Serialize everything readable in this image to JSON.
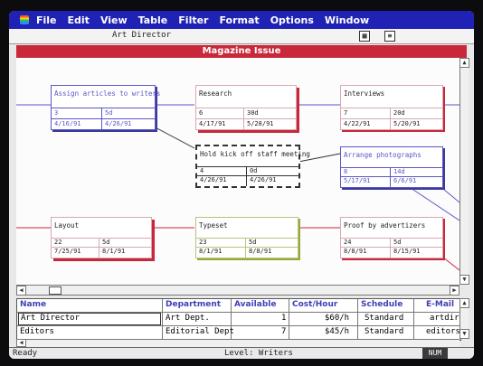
{
  "menubar": {
    "items": [
      "File",
      "Edit",
      "View",
      "Table",
      "Filter",
      "Format",
      "Options",
      "Window"
    ]
  },
  "toolbar": {
    "resource_name": "Art Director"
  },
  "window": {
    "title": "Magazine Issue"
  },
  "tasks": [
    {
      "name": "Assign articles to writers",
      "id": "3",
      "duration": "5d",
      "start": "4/16/91",
      "end": "4/26/91",
      "style": "blue"
    },
    {
      "name": "Research",
      "id": "6",
      "duration": "30d",
      "start": "4/17/91",
      "end": "5/28/91",
      "style": "red"
    },
    {
      "name": "Interviews",
      "id": "7",
      "duration": "20d",
      "start": "4/22/91",
      "end": "5/20/91",
      "style": "pink"
    },
    {
      "name": "Hold kick off staff meeting",
      "id": "4",
      "duration": "0d",
      "start": "4/26/91",
      "end": "4/26/91",
      "style": "dashed"
    },
    {
      "name": "Arrange photographs",
      "id": "8",
      "duration": "14d",
      "start": "5/17/91",
      "end": "6/6/91",
      "style": "blue"
    },
    {
      "name": "Layout",
      "id": "22",
      "duration": "5d",
      "start": "7/25/91",
      "end": "8/1/91",
      "style": "red"
    },
    {
      "name": "Typeset",
      "id": "23",
      "duration": "5d",
      "start": "8/1/91",
      "end": "8/8/91",
      "style": "yellow"
    },
    {
      "name": "Proof by advertizers",
      "id": "24",
      "duration": "5d",
      "start": "8/8/91",
      "end": "8/15/91",
      "style": "pink"
    }
  ],
  "resources": {
    "columns": [
      "Name",
      "Department",
      "Available",
      "Cost/Hour",
      "Schedule",
      "E-Mail"
    ],
    "rows": [
      {
        "name": "Art Director",
        "department": "Art Dept.",
        "available": "1",
        "cost": "$60/h",
        "schedule": "Standard",
        "email": "artdir"
      },
      {
        "name": "Editors",
        "department": "Editorial Dept",
        "available": "7",
        "cost": "$45/h",
        "schedule": "Standard",
        "email": "editors"
      }
    ]
  },
  "status": {
    "ready": "Ready",
    "level": "Level: Writers",
    "num": "NUM"
  },
  "colors": {
    "menubar": "#1f22b4",
    "window_title": "#c8283a",
    "blue_box": "#5a56c6",
    "red_shadow": "#c8283a",
    "yellow_box": "#b9c47a"
  },
  "icons": [
    "apple-menu-icon",
    "calendar-icon",
    "list-icon",
    "scroll-up-icon",
    "scroll-down-icon",
    "scroll-left-icon",
    "scroll-right-icon"
  ]
}
